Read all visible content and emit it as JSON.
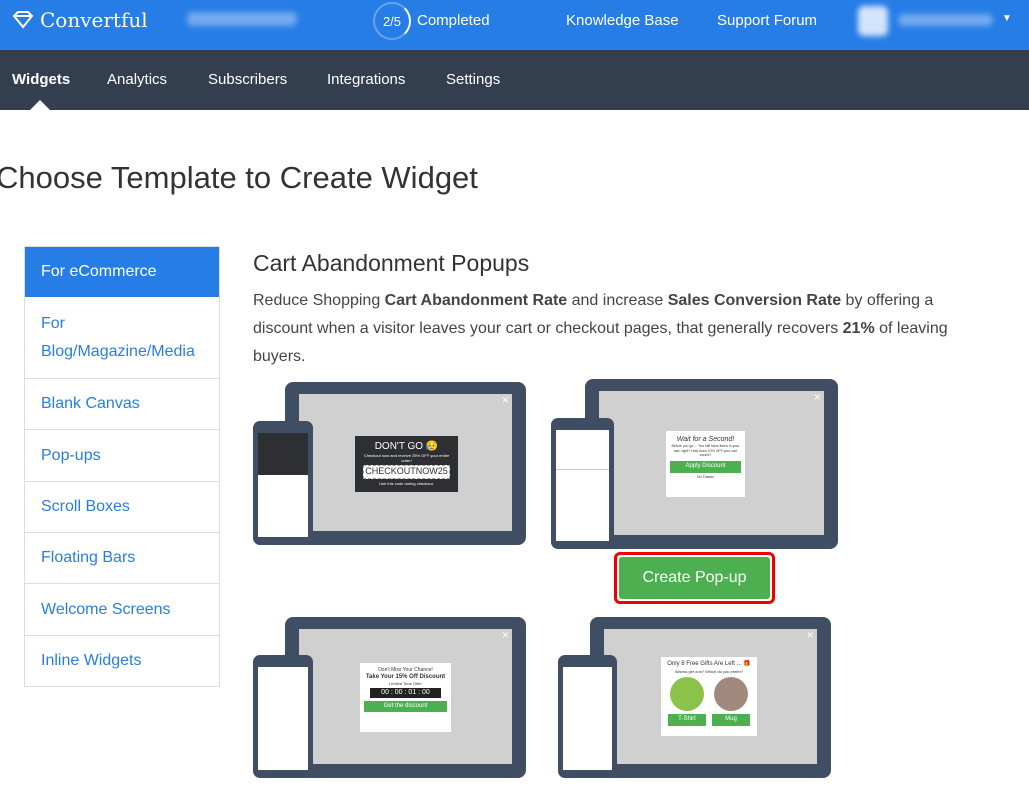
{
  "header": {
    "brand": "Convertful",
    "progress": "2/5",
    "progress_fraction": 0.4,
    "progress_label": "Completed",
    "links": [
      "Knowledge Base",
      "Support Forum"
    ]
  },
  "nav": {
    "items": [
      "Widgets",
      "Analytics",
      "Subscribers",
      "Integrations",
      "Settings"
    ],
    "active": "Widgets"
  },
  "page_title": "Choose Template to Create Widget",
  "sidebar": {
    "items": [
      "For eCommerce",
      "For Blog/Magazine/Media",
      "Blank Canvas",
      "Pop-ups",
      "Scroll Boxes",
      "Floating Bars",
      "Welcome Screens",
      "Inline Widgets"
    ],
    "active": "For eCommerce"
  },
  "section": {
    "title": "Cart Abandonment Popups",
    "desc": [
      {
        "t": "Reduce Shopping "
      },
      {
        "t": "Cart Abandonment Rate",
        "b": true
      },
      {
        "t": " and increase "
      },
      {
        "t": "Sales Conversion Rate",
        "b": true
      },
      {
        "t": " by offering a discount when a visitor leaves your cart or checkout pages, that generally recovers "
      },
      {
        "t": "21%",
        "b": true
      },
      {
        "t": " of leaving buyers."
      }
    ]
  },
  "templates": [
    {
      "title": "DON'T GO 😥",
      "text": "Checkout now and receive 25% OFF your entire order!",
      "code": "CHECKOUTNOW25",
      "note": "Use this code during checkout."
    },
    {
      "title": "Wait for a Second!",
      "text": "Before you go ... You still have items in your cart, right? How does 10% OFF your cart sound?",
      "button": "Apply Discount",
      "note": "No Thanks"
    },
    {
      "title": "Don't Miss Your Chance!",
      "text": "Take Your 15% Off Discount",
      "code": "00 : 00 : 01 : 00",
      "note": "Limited Time Offer",
      "button": "Get the discount"
    },
    {
      "title": "Only 8 Free Gifts Are Left ... 🎁",
      "text": "Wanna get one? Which do you prefer?",
      "button": "T-Shirt",
      "note": "Mug"
    }
  ],
  "create_button": "Create Pop-up",
  "colors": {
    "primary": "#277de6",
    "nav": "#333f4f",
    "green": "#4caf50",
    "highlight": "#e00000"
  }
}
